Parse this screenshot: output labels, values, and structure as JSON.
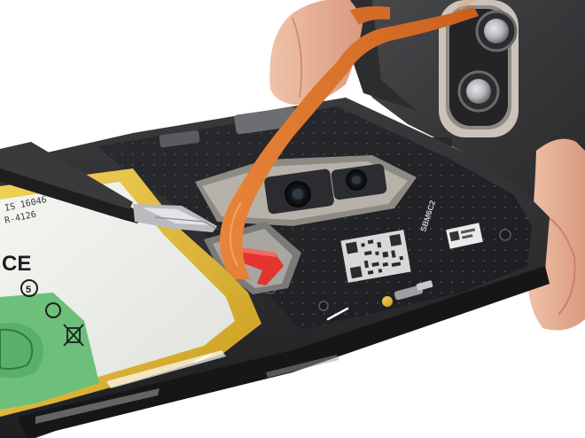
{
  "photo": {
    "battery_markings": {
      "line1": "IS 16046",
      "line2": "R-4126"
    },
    "board_labels": {
      "flex_label": "SBM6C2",
      "tag_label": "SBM6C2"
    },
    "colors": {
      "background": "#ffffff",
      "phone_frame": "#2b2b2e",
      "back_cover": "#3a3a3c",
      "battery_cell": "#eef0ec",
      "battery_wrap": "#e4c23c",
      "flex_cable": "#e0782a",
      "pull_tab": "#e3342f",
      "tweezers": "#2a2a2a",
      "skin": "#e8b49a",
      "green_sticker": "#6cc07a"
    }
  }
}
